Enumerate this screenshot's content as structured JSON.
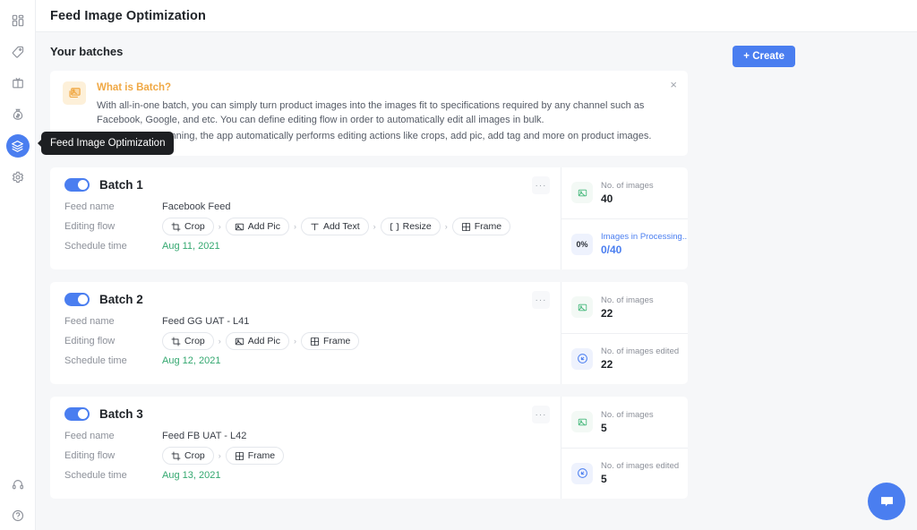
{
  "app": {
    "title": "Feed Image Optimization"
  },
  "sidebar": {
    "items": [
      {
        "icon": "dashboard-icon",
        "label": "Dashboard"
      },
      {
        "icon": "tag-icon",
        "label": "Tags"
      },
      {
        "icon": "box-icon",
        "label": "Products"
      },
      {
        "icon": "money-bag-icon",
        "label": "Billing"
      },
      {
        "icon": "layers-icon",
        "label": "Feed Image Optimization",
        "active": true
      },
      {
        "icon": "gear-icon",
        "label": "Settings"
      }
    ],
    "bottom_items": [
      {
        "icon": "headset-icon",
        "label": "Support"
      },
      {
        "icon": "help-circle-icon",
        "label": "Help"
      }
    ],
    "tooltip": "Feed Image Optimization",
    "accent_color": "#4a7ef0"
  },
  "section": {
    "title": "Your batches",
    "create_label": "+ Create"
  },
  "banner": {
    "icon": "images-icon",
    "title": "What is Batch?",
    "paragraphs": [
      "With all-in-one batch, you can simply turn product images into the images fit to specifications required by any channel such as Facebook, Google, and etc. You can define editing flow in order to automatically edit all images in bulk.",
      "When batch is running, the app automatically performs editing actions like crops, add pic, add tag and more on product images."
    ],
    "close_label": "×",
    "accent_color": "#f0a844"
  },
  "labels": {
    "feed_name": "Feed name",
    "editing_flow": "Editing flow",
    "schedule_time": "Schedule time",
    "menu_dots": "···",
    "chevron": "›"
  },
  "batches": [
    {
      "name": "Batch 1",
      "enabled": true,
      "feed_name": "Facebook Feed",
      "flow": [
        {
          "label": "Crop",
          "icon": "crop-icon"
        },
        {
          "label": "Add Pic",
          "icon": "image-icon"
        },
        {
          "label": "Add Text",
          "icon": "text-icon"
        },
        {
          "label": "Resize",
          "icon": "resize-icon"
        },
        {
          "label": "Frame",
          "icon": "frame-icon"
        }
      ],
      "schedule_time": "Aug 11, 2021",
      "stats": [
        {
          "icon": "image-icon",
          "style": "green",
          "label": "No. of images",
          "value": "40"
        },
        {
          "icon": "percent-badge",
          "style": "percent",
          "badge": "0%",
          "label": "Images in Processing...",
          "value": "0/40",
          "link": true
        }
      ]
    },
    {
      "name": "Batch 2",
      "enabled": true,
      "feed_name": "Feed GG UAT - L41",
      "flow": [
        {
          "label": "Crop",
          "icon": "crop-icon"
        },
        {
          "label": "Add Pic",
          "icon": "image-icon"
        },
        {
          "label": "Frame",
          "icon": "frame-icon"
        }
      ],
      "schedule_time": "Aug 12, 2021",
      "stats": [
        {
          "icon": "image-icon",
          "style": "green",
          "label": "No. of images",
          "value": "22"
        },
        {
          "icon": "edited-icon",
          "style": "blue",
          "label": "No. of images edited",
          "value": "22"
        }
      ]
    },
    {
      "name": "Batch 3",
      "enabled": true,
      "feed_name": "Feed FB UAT - L42",
      "flow": [
        {
          "label": "Crop",
          "icon": "crop-icon"
        },
        {
          "label": "Frame",
          "icon": "frame-icon"
        }
      ],
      "schedule_time": "Aug 13, 2021",
      "stats": [
        {
          "icon": "image-icon",
          "style": "green",
          "label": "No. of images",
          "value": "5"
        },
        {
          "icon": "edited-icon",
          "style": "blue",
          "label": "No. of images edited",
          "value": "5"
        }
      ]
    }
  ],
  "chat": {
    "icon": "chat-bubble-icon",
    "label": "Chat"
  }
}
